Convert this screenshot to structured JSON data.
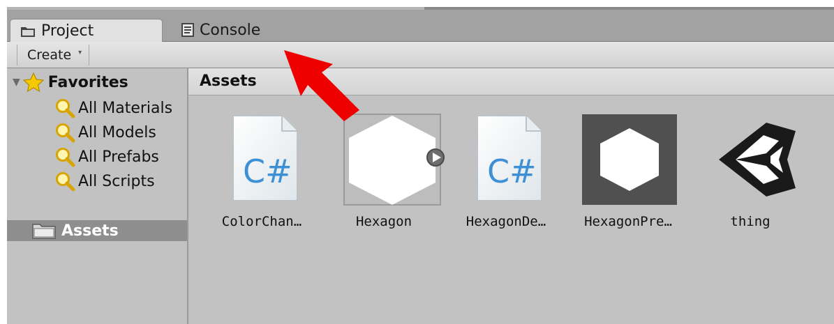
{
  "tabs": [
    {
      "label": "Project",
      "icon": "folder-icon",
      "active": true
    },
    {
      "label": "Console",
      "icon": "console-icon",
      "active": false
    }
  ],
  "toolbar": {
    "create_label": "Create",
    "create_caret": "▾"
  },
  "sidebar": {
    "favorites_label": "Favorites",
    "favorites": [
      {
        "label": "All Materials"
      },
      {
        "label": "All Models"
      },
      {
        "label": "All Prefabs"
      },
      {
        "label": "All Scripts"
      }
    ],
    "assets_label": "Assets"
  },
  "main": {
    "header": "Assets",
    "items": [
      {
        "name": "ColorChan…",
        "kind": "csharp-script"
      },
      {
        "name": "Hexagon",
        "kind": "sprite"
      },
      {
        "name": "HexagonDe…",
        "kind": "csharp-script"
      },
      {
        "name": "HexagonPre…",
        "kind": "prefab"
      },
      {
        "name": "thing",
        "kind": "unity-scene"
      }
    ]
  },
  "colors": {
    "arrow": "#ef0000",
    "selection": "#8e8e8e",
    "panel": "#c2c2c2"
  }
}
